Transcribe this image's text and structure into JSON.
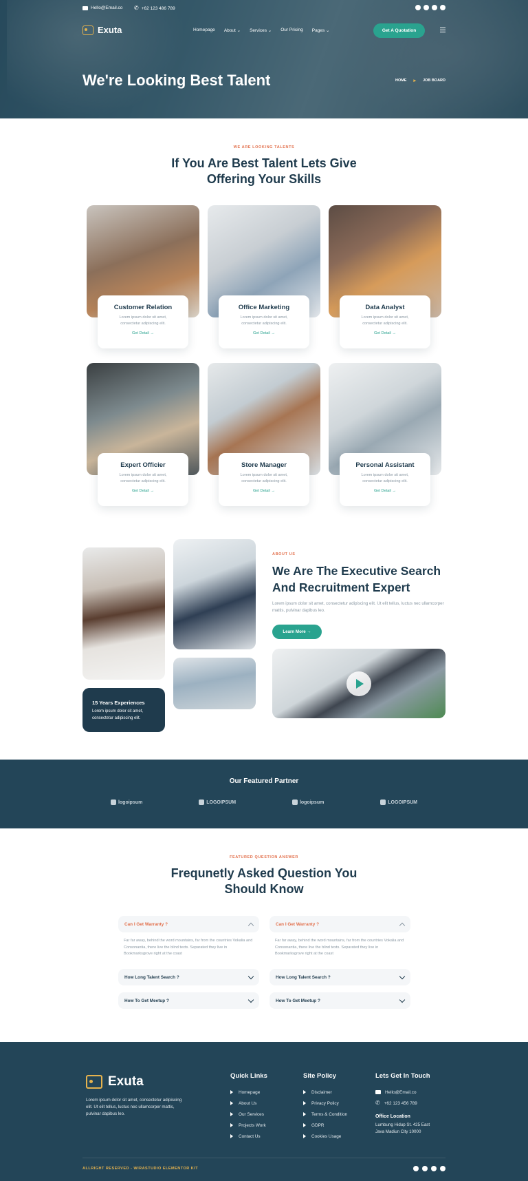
{
  "topbar": {
    "email": "Hello@Email.co",
    "phone": "+62 123 486 789",
    "social_icons": [
      "facebook-icon",
      "twitter-icon",
      "youtube-icon",
      "pinterest-icon"
    ]
  },
  "brand": {
    "name": "Exuta"
  },
  "nav": {
    "items": [
      "Homepage",
      "About ⌄",
      "Services ⌄",
      "Our Pricing",
      "Pages ⌄"
    ],
    "cta": "Get A Quotation"
  },
  "hero": {
    "title": "We're Looking Best Talent",
    "breadcrumb": [
      "HOME",
      "JOB BOARD"
    ]
  },
  "talent": {
    "kicker": "WE ARE LOOKING TALENTS",
    "title_line1": "If You Are Best Talent Lets Give",
    "title_line2": "Offering Your Skills",
    "cards": [
      {
        "title": "Customer Relation",
        "desc1": "Lorem ipsum dolor sit amet,",
        "desc2": "consectetur adipiscing elit.",
        "link": "Get Detail →"
      },
      {
        "title": "Office Marketing",
        "desc1": "Lorem ipsum dolor sit amet,",
        "desc2": "consectetur adipiscing elit.",
        "link": "Get Detail →"
      },
      {
        "title": "Data Analyst",
        "desc1": "Lorem ipsum dolor sit amet,",
        "desc2": "consectetur adipiscing elit.",
        "link": "Get Detail →"
      },
      {
        "title": "Expert Officier",
        "desc1": "Lorem ipsum dolor sit amet,",
        "desc2": "consectetur adipiscing elit.",
        "link": "Get Detail →"
      },
      {
        "title": "Store Manager",
        "desc1": "Lorem ipsum dolor sit amet,",
        "desc2": "consectetur adipiscing elit.",
        "link": "Get Detail →"
      },
      {
        "title": "Personal Assistant",
        "desc1": "Lorem ipsum dolor sit amet,",
        "desc2": "consectetur adipiscing elit.",
        "link": "Get Detail →"
      }
    ]
  },
  "about": {
    "kicker": "ABOUT US",
    "title": "We Are The Executive Search And Recruitment Expert",
    "text": "Lorem ipsum dolor sit amet, consectetur adipiscing elit. Ut elit tellus, luctus nec ullamcorper mattis, pulvinar dapibus leo.",
    "button": "Learn More →",
    "experience_title": "15 Years Experiences",
    "experience_text": "Lorem ipsum dolor sit amet, consectetur adipiscing elit."
  },
  "partner": {
    "title": "Our Featured Partner",
    "logos": [
      "logoipsum",
      "LOGOIPSUM",
      "logoipsum",
      "LOGOIPSUM"
    ]
  },
  "faq": {
    "kicker": "FEATURED QUESTION ANSWER",
    "title_line1": "Frequnetly Asked Question You",
    "title_line2": "Should Know",
    "left": [
      {
        "q": "Can I Get Warranty ?",
        "open": true,
        "answer": "Far far away, behind the word mountains, far from the countries Vokalia and Consonantia, there live the blind texts. Separated they live in Bookmarksgrove right at the coast"
      },
      {
        "q": "How Long Talent Search ?",
        "open": false
      },
      {
        "q": "How To Get Meetup ?",
        "open": false
      }
    ],
    "right": [
      {
        "q": "Can I Get Warranty ?",
        "open": true,
        "answer": "Far far away, behind the word mountains, far from the countries Vokalia and Consonantia, there live the blind texts. Separated they live in Bookmarksgrove right at the coast"
      },
      {
        "q": "How Long Talent Search ?",
        "open": false
      },
      {
        "q": "How To Get Meetup ?",
        "open": false
      }
    ]
  },
  "footer": {
    "about": "Lorem ipsum dolor sit amet, consectetur adipiscing elit. Ut elit tellus, luctus nec ullamcorper mattis, pulvinar dapibus leo.",
    "quick_links_title": "Quick Links",
    "quick_links": [
      "Homepage",
      "About Us",
      "Our Services",
      "Projects Work",
      "Contact Us"
    ],
    "policy_title": "Site Policy",
    "policy_links": [
      "Disclaimer",
      "Privacy Policy",
      "Terms & Condition",
      "GDPR",
      "Cookies Usage"
    ],
    "contact_title": "Lets Get In Touch",
    "email": "Hello@Email.co",
    "phone": "+62 123 456 789",
    "location_title": "Office Location",
    "location_line1": "Lumbung Hidup St. 425 East",
    "location_line2": "Java Madiun City 10000",
    "copyright": "ALLRIGHT RESERVED - WIRASTUDIO ELEMENTOR KIT"
  },
  "colors": {
    "primary": "#1f3b4d",
    "accent": "#2aa38f",
    "highlight": "#e2704c",
    "gold": "#e6b34e"
  }
}
